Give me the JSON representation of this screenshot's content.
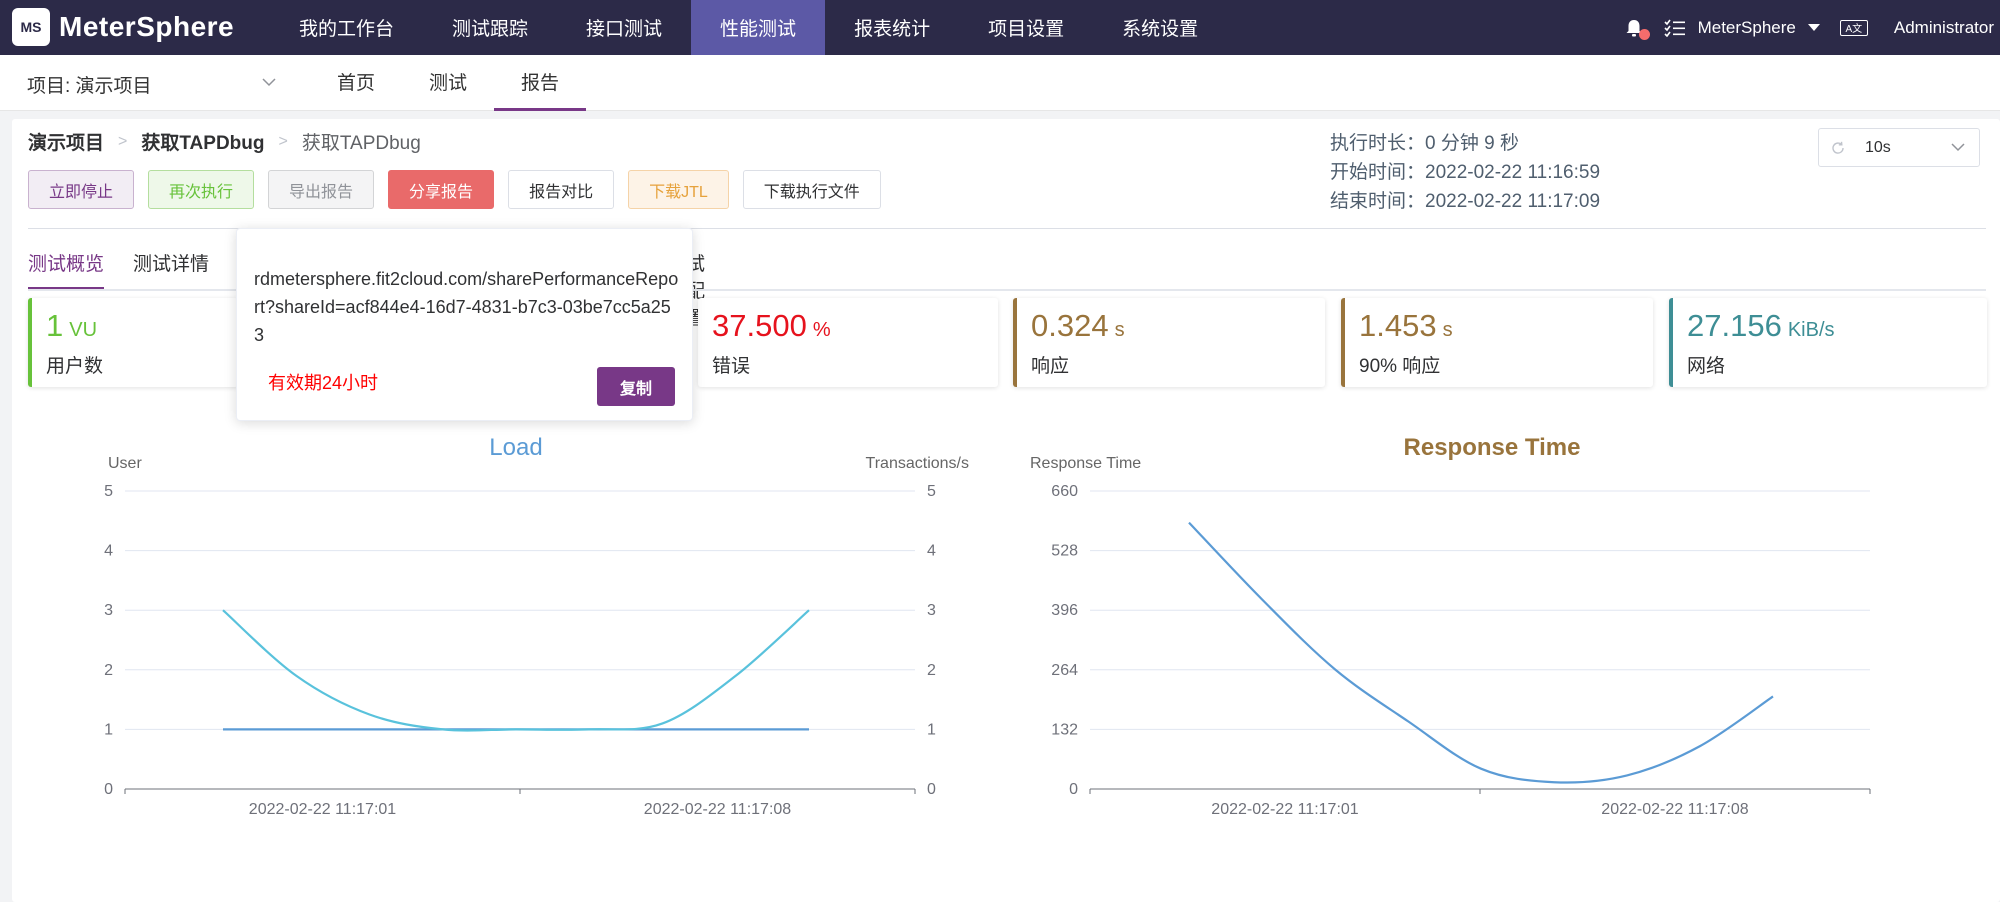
{
  "topbar": {
    "logo_mark": "MS",
    "logo_text": "MeterSphere",
    "nav": [
      "我的工作台",
      "测试跟踪",
      "接口测试",
      "性能测试",
      "报表统计",
      "项目设置",
      "系统设置"
    ],
    "active_nav": "性能测试",
    "org": "MeterSphere",
    "lang_icon": "A文",
    "user": "Administrator"
  },
  "subbar": {
    "project": "项目: 演示项目",
    "tabs": [
      "首页",
      "测试",
      "报告"
    ],
    "active_tab": "报告"
  },
  "breadcrumb": [
    "演示项目",
    "获取TAPDbug",
    "获取TAPDbug"
  ],
  "toolbar": {
    "stop": "立即停止",
    "rerun": "再次执行",
    "export": "导出报告",
    "share": "分享报告",
    "compare": "报告对比",
    "download_jtl": "下载JTL",
    "download_file": "下载执行文件"
  },
  "meta": {
    "duration": "执行时长：0 分钟 9 秒",
    "start": "开始时间：2022-02-22 11:16:59",
    "end": "结束时间：2022-02-22 11:17:09"
  },
  "refresh": {
    "value": "10s"
  },
  "tabs": {
    "overview": "测试概览",
    "details": "测试详情",
    "config": "试配置"
  },
  "metrics": [
    {
      "value": "1",
      "unit": "VU",
      "label": "用户数",
      "color": "#67c23a"
    },
    {
      "value": "37.500",
      "unit": "%",
      "label": "错误",
      "color": "#e6121d"
    },
    {
      "value": "0.324",
      "unit": "s",
      "label": "响应",
      "color": "#99743c"
    },
    {
      "value": "1.453",
      "unit": "s",
      "label": "90% 响应",
      "color": "#99743c"
    },
    {
      "value": "27.156",
      "unit": "KiB/s",
      "label": "网络",
      "color": "#3e8e95"
    }
  ],
  "popover": {
    "url": "rdmetersphere.fit2cloud.com/sharePerformanceReport?shareId=acf844e4-16d7-4831-b7c3-03be7cc5a253",
    "validity": "有效期24小时",
    "copy": "复制"
  },
  "chart_data": [
    {
      "type": "line",
      "title": "Load",
      "ylabel": "User",
      "y2label": "Transactions/s",
      "ylim": [
        0,
        5
      ],
      "y2lim": [
        0,
        5
      ],
      "yticks": [
        "0",
        "1",
        "2",
        "3",
        "4",
        "5"
      ],
      "xticks": [
        "2022-02-22 11:17:01",
        "2022-02-22 11:17:08"
      ],
      "title_color": "#5b9bd5",
      "series": [
        {
          "values": [
            1,
            1,
            1,
            1,
            1,
            1,
            1,
            1,
            1
          ],
          "color": "#5b9bd5"
        },
        {
          "values": [
            3,
            1.9,
            1.25,
            1,
            1,
            1,
            1.1,
            1.9,
            3
          ],
          "color": "#59c2dc"
        }
      ]
    },
    {
      "type": "line",
      "title": "Response Time",
      "ylabel": "Response Time",
      "ylim": [
        0,
        660
      ],
      "yticks": [
        "0",
        "132",
        "264",
        "396",
        "528",
        "660"
      ],
      "xticks": [
        "2022-02-22 11:17:01",
        "2022-02-22 11:17:08"
      ],
      "title_color": "#99743c",
      "series": [
        {
          "values": [
            590,
            420,
            265,
            150,
            45,
            15,
            30,
            95,
            205
          ],
          "color": "#5b9bd5"
        }
      ]
    }
  ]
}
